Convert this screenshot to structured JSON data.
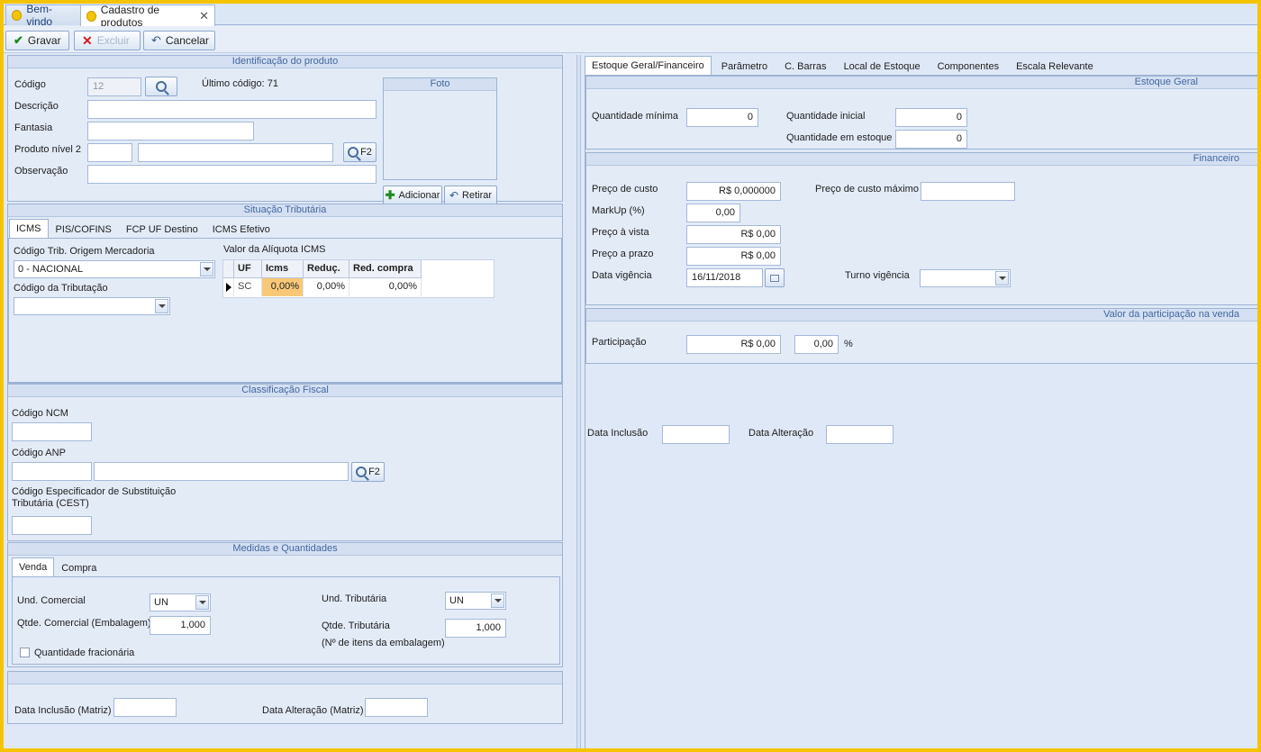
{
  "tabs": [
    {
      "label": "Bem-vindo"
    },
    {
      "label": "Cadastro de produtos"
    }
  ],
  "toolbar": {
    "save": "Gravar",
    "delete": "Excluir",
    "cancel": "Cancelar"
  },
  "identificacao": {
    "title": "Identificação do produto",
    "codigo_label": "Código",
    "codigo_value": "12",
    "ultimo_codigo": "Último código: 71",
    "descricao_label": "Descrição",
    "fantasia_label": "Fantasia",
    "produto_nivel2_label": "Produto nível 2",
    "observacao_label": "Observação",
    "f2": "F2",
    "foto_title": "Foto",
    "adicionar": "Adicionar",
    "retirar": "Retirar"
  },
  "situacao": {
    "title": "Situação Tributária",
    "tabs": [
      "ICMS",
      "PIS/COFINS",
      "FCP UF Destino",
      "ICMS Efetivo"
    ],
    "origem_label": "Código Trib. Origem Mercadoria",
    "origem_value": "0 - NACIONAL",
    "tributacao_label": "Código da Tributação",
    "aliquota_label": "Valor da Alíquota ICMS",
    "grid_headers": [
      "UF",
      "Icms",
      "Reduç.",
      "Red. compra"
    ],
    "grid_row": [
      "SC",
      "0,00%",
      "0,00%",
      "0,00%"
    ]
  },
  "classificacao": {
    "title": "Classificação Fiscal",
    "ncm_label": "Código NCM",
    "anp_label": "Código ANP",
    "cest_label_1": "Código Especificador de Substituição",
    "cest_label_2": "Tributária (CEST)",
    "f2": "F2"
  },
  "medidas": {
    "title": "Medidas e Quantidades",
    "tabs": [
      "Venda",
      "Compra"
    ],
    "und_comercial_label": "Und. Comercial",
    "und_comercial_value": "UN",
    "qtde_comercial_label": "Qtde. Comercial (Embalagem)",
    "qtde_comercial_value": "1,000",
    "fracionaria_label": "Quantidade fracionária",
    "und_tributaria_label": "Und. Tributária",
    "und_tributaria_value": "UN",
    "qtde_tributaria_label": "Qtde. Tributária",
    "qtde_tributaria_value": "1,000",
    "itens_label": "(Nº de itens da embalagem)"
  },
  "matriz": {
    "inclusao_label": "Data Inclusão (Matriz)",
    "alteracao_label": "Data Alteração (Matriz)"
  },
  "right_tabs": [
    "Estoque Geral/Financeiro",
    "Parâmetro",
    "C. Barras",
    "Local de Estoque",
    "Componentes",
    "Escala Relevante"
  ],
  "estoque": {
    "title": "Estoque Geral",
    "qtd_minima_label": "Quantidade mínima",
    "qtd_minima_value": "0",
    "qtd_inicial_label": "Quantidade inicial",
    "qtd_inicial_value": "0",
    "qtd_estoque_label": "Quantidade em estoque",
    "qtd_estoque_value": "0"
  },
  "financeiro": {
    "title": "Financeiro",
    "custo_label": "Preço de custo",
    "custo_value": "R$ 0,000000",
    "custo_max_label": "Preço de custo máximo",
    "markup_label": "MarkUp (%)",
    "markup_value": "0,00",
    "vista_label": "Preço à vista",
    "vista_value": "R$ 0,00",
    "prazo_label": "Preço a prazo",
    "prazo_value": "R$ 0,00",
    "vigencia_label": "Data vigência",
    "vigencia_value": "16/11/2018",
    "turno_label": "Turno vigência"
  },
  "participacao": {
    "title": "Valor da participação na venda",
    "label": "Participação",
    "valor": "R$ 0,00",
    "percent": "0,00",
    "percent_sign": "%"
  },
  "datas": {
    "inclusao_label": "Data Inclusão",
    "alteracao_label": "Data Alteração"
  },
  "colors": {
    "frame": "#f5c400",
    "panel": "#e3ebf7",
    "title_text": "#4466a0"
  }
}
